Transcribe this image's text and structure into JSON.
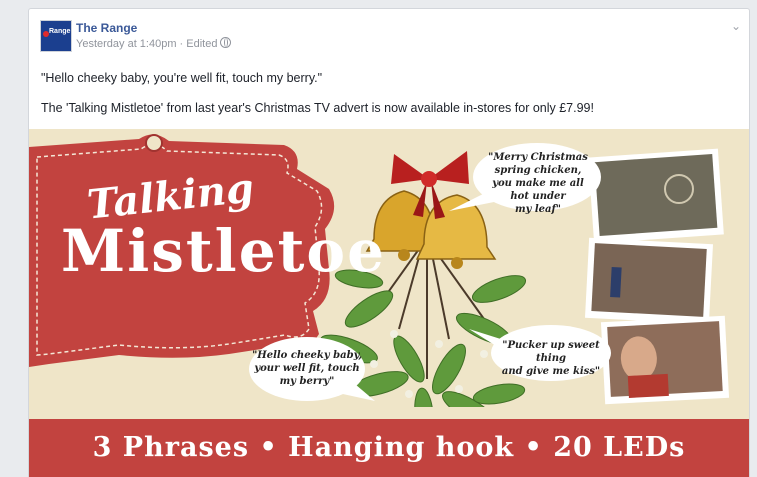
{
  "post": {
    "page_name": "The Range",
    "timestamp": "Yesterday at 1:40pm",
    "separator": " · ",
    "edited": "Edited",
    "avatar_text": "Range",
    "message_line1": "\"Hello cheeky baby, you're well fit, touch my berry.\"",
    "message_line2": "The 'Talking Mistletoe' from last year's Christmas TV advert is now available in-stores for only £7.99!"
  },
  "promo": {
    "title_line1": "Talking",
    "title_line2": "Mistletoe",
    "bubble_top_right": [
      "\"Merry Christmas",
      "spring chicken,",
      "you make me all hot under",
      "my leaf\""
    ],
    "bubble_bottom_left": [
      "\"Hello cheeky baby,",
      "your well fit, touch",
      "my berry\""
    ],
    "bubble_bottom_right": [
      "\"Pucker up sweet thing",
      "and give me kiss\""
    ],
    "banner": "3 Phrases • Hanging hook • 20 LEDs"
  },
  "colors": {
    "link": "#3b5998",
    "promo_red": "#c2433f",
    "promo_bg": "#efe5c8",
    "leaf_green": "#5f9a3c",
    "gold": "#d9a52c"
  },
  "icons": [
    "globe-icon",
    "chevron-down-icon"
  ]
}
